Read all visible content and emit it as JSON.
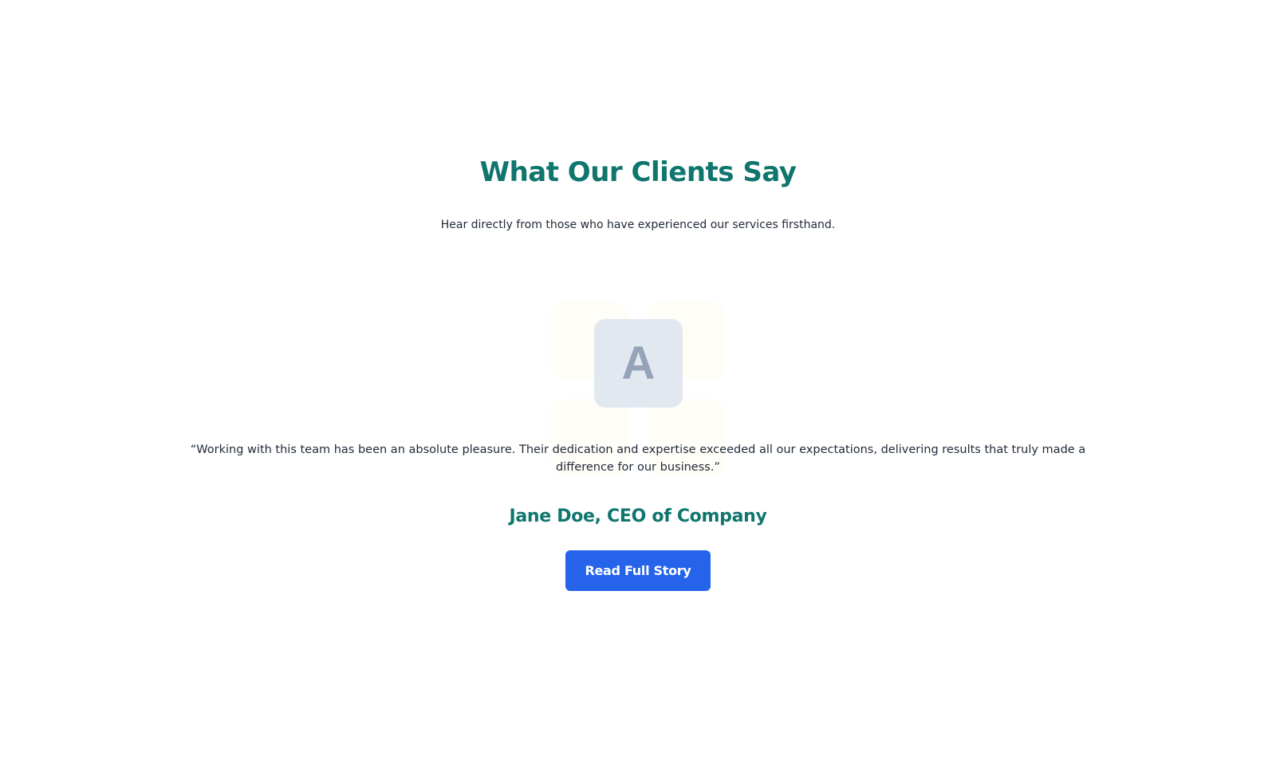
{
  "testimonials": {
    "heading": "What Our Clients Say",
    "subheading": "Hear directly from those who have experienced our services firsthand.",
    "avatar_initial": "A",
    "quote": "“Working with this team has been an absolute pleasure. Their dedication and expertise exceeded all our expectations, delivering results that truly made a difference for our business.”",
    "author": "Jane Doe, CEO of Company",
    "cta_label": "Read Full Story"
  },
  "colors": {
    "heading": "#0f766e",
    "button": "#2563eb",
    "avatar_bg": "#e2e8f0",
    "avatar_letter": "#94a3b8",
    "text": "#1f2937"
  }
}
